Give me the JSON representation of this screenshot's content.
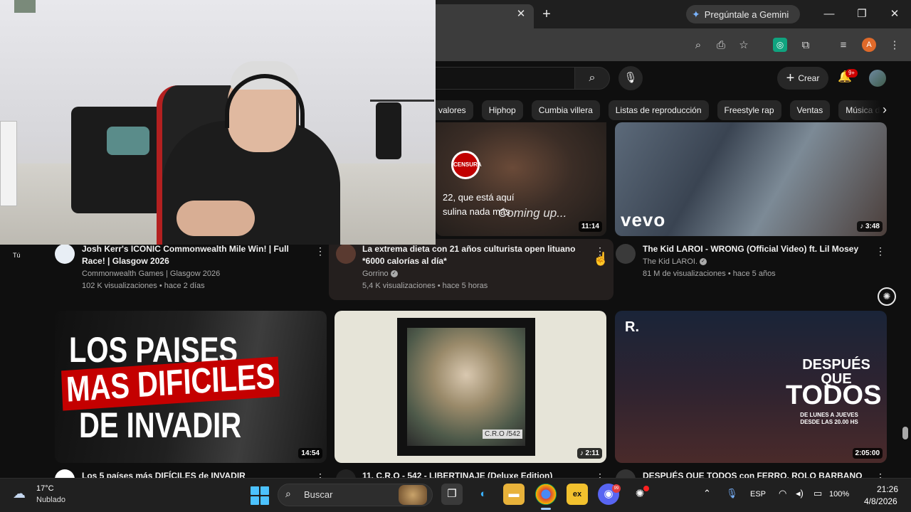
{
  "browser": {
    "tab_close": "✕",
    "new_tab": "+",
    "gemini_label": "Pregúntale a Gemini",
    "profile_initial": "A"
  },
  "youtube": {
    "create_label": "Crear",
    "notif_badge": "9+",
    "chips": [
      "valores",
      "Hiphop",
      "Cumbia villera",
      "Listas de reproducción",
      "Freestyle rap",
      "Ventas",
      "Música dance el"
    ],
    "sidebar_tu": "Tú",
    "videos": [
      {
        "title": "Josh Kerr's ICONIC Commonwealth Mile Win! | Full Race! | Glasgow 2026",
        "channel": "Commonwealth Games | Glasgow 2026",
        "stats": "102 K visualizaciones • hace 2 días"
      },
      {
        "title": "La extrema dieta con 21 años culturista open lituano *6000 calorías al día*",
        "channel": "Gorrino",
        "stats": "5,4 K visualizaciones • hace 5 horas",
        "duration": "11:14",
        "thumb_censura": "CENSURA",
        "thumb_sub1": "22, que está aquí",
        "thumb_sub2": "sulina nada más",
        "thumb_coming": "Coming up..."
      },
      {
        "title": "The Kid LAROI - WRONG (Official Video) ft. Lil Mosey",
        "channel": "The Kid LAROI.",
        "stats": "81 M de visualizaciones • hace 5 años",
        "duration": "♪ 3:48",
        "thumb_logo": "vevo"
      },
      {
        "title": "Los 5 países más DIFÍCILES de INVADIR",
        "duration": "14:54",
        "thumb_l1": "LOS PAISES",
        "thumb_l2": "MAS DIFICILES",
        "thumb_l3": "DE INVADIR"
      },
      {
        "title": "11. C.R.O - 542 - LIBERTINAJE (Deluxe Edition)",
        "duration": "♪ 2:11",
        "thumb_label": "C.R.O /542"
      },
      {
        "title": "DESPUÉS QUE TODOS con FERRO, ROLO BARBANO",
        "duration": "2:05:00",
        "thumb_r": "R.",
        "thumb_despues": "DESPUÉS QUE",
        "thumb_todos": "TODOS",
        "thumb_lunes": "DE LUNES A JUEVES DESDE LAS 20.00 HS"
      }
    ]
  },
  "taskbar": {
    "temp": "17°C",
    "weather": "Nublado",
    "search_placeholder": "Buscar",
    "lang": "ESP",
    "battery": "100%",
    "time": "21:26",
    "date": "4/8/2026",
    "discord_badge": "99"
  }
}
